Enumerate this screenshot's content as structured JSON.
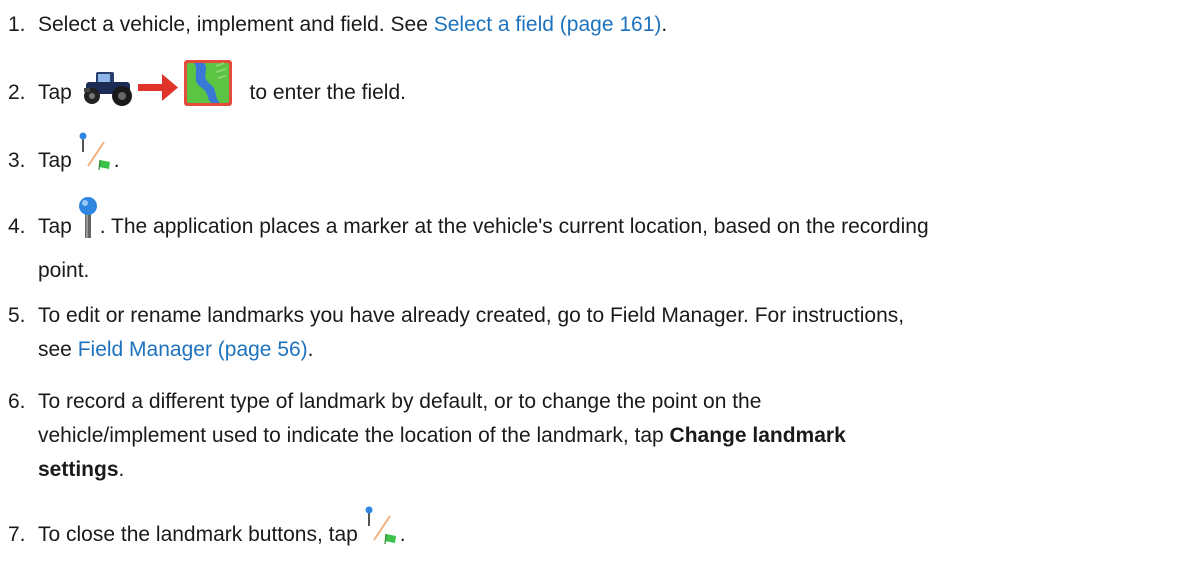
{
  "steps": [
    {
      "num": "1.",
      "text_before": "Select a vehicle, implement and field. See ",
      "link": "Select a field (page 161)",
      "text_after": "."
    },
    {
      "num": "2.",
      "text_before": "Tap ",
      "icon": "tractor-to-field-icon",
      "text_after": " to enter the field."
    },
    {
      "num": "3.",
      "text_before": "Tap ",
      "icon": "landmark-toggle-icon",
      "text_after": "."
    },
    {
      "num": "4.",
      "text_before": "Tap ",
      "icon": "pin-marker-icon",
      "text_after": ". The application places a marker at the vehicle's current location, based on the recording",
      "text_line2": "point."
    },
    {
      "num": "5.",
      "text_before": "To edit or rename landmarks you have already created, go to Field Manager. For instructions,",
      "text_line2_before": "see ",
      "link": "Field Manager (page 56)",
      "text_after": "."
    },
    {
      "num": "6.",
      "text_line1": "To record a different type of landmark by default, or to change the point on the",
      "text_line2_before": "vehicle/implement used to indicate the location of the landmark, tap ",
      "bold": "Change landmark",
      "bold_line3": "settings",
      "text_after": "."
    },
    {
      "num": "7.",
      "text_before": "To close the landmark buttons, tap ",
      "icon": "landmark-toggle-icon",
      "text_after": "."
    }
  ],
  "colors": {
    "link": "#1e73be",
    "text": "#1a1a1a",
    "arrow": "#e0342a",
    "field_green": "#5cc443",
    "field_blue": "#3a78d8",
    "pin_blue": "#2f86e0"
  }
}
